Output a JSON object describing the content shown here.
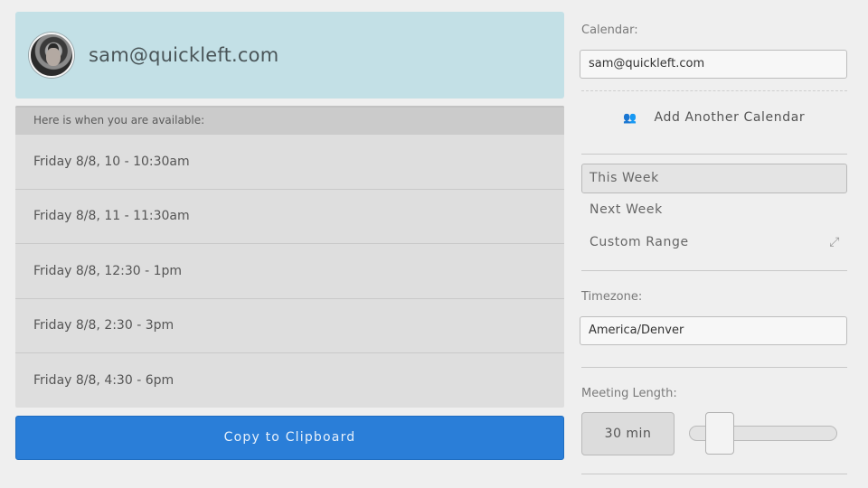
{
  "account": {
    "email": "sam@quickleft.com",
    "avatar_icon": "user-avatar-photo"
  },
  "availability": {
    "header": "Here is when you are available:",
    "slots": [
      "Friday 8/8, 10 - 10:30am",
      "Friday 8/8, 11 - 11:30am",
      "Friday 8/8, 12:30 - 1pm",
      "Friday 8/8, 2:30 - 3pm",
      "Friday 8/8, 4:30 - 6pm"
    ],
    "copy_label": "Copy to Clipboard"
  },
  "settings": {
    "calendar_label": "Calendar:",
    "calendar_value": "sam@quickleft.com",
    "add_calendar_label": "Add Another Calendar",
    "add_calendar_icon": "people-icon",
    "range_options": [
      "This Week",
      "Next Week",
      "Custom Range"
    ],
    "range_selected": "This Week",
    "custom_range_icon": "expand-arrows-icon",
    "timezone_label": "Timezone:",
    "timezone_value": "America/Denver",
    "meeting_length_label": "Meeting Length:",
    "meeting_length_value": "30 min",
    "meeting_length_slider_fraction": 0.1
  },
  "colors": {
    "account_card_bg": "#c3e0e6",
    "primary_button": "#2a7ed8",
    "page_bg": "#efefef"
  }
}
